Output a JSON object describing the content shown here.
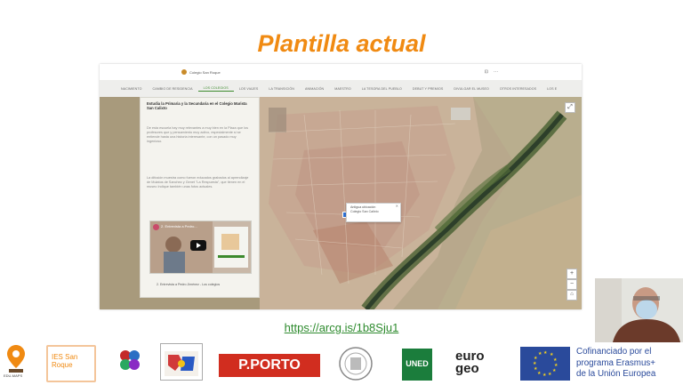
{
  "slide": {
    "title": "Plantilla actual",
    "link": "https://arcg.is/1b8Sju1"
  },
  "app": {
    "brand": "Colegio San Roque",
    "nav": [
      "NACIMIENTO",
      "CAMBIO DE RESIDENCIA",
      "LOS COLEGIOS",
      "LOS VIAJES",
      "LA TRANSICIÓN",
      "ANIMACIÓN",
      "MAESTRO",
      "LA TESORA DEL PUEBLO",
      "DEBUT Y PREMIOS",
      "DIVULGAR EL MUSEO",
      "OTROS INTERESADOS",
      "LOS E"
    ],
    "active_nav": "LOS COLEGIOS",
    "panel": {
      "heading": "Estudia la Primaria y la Secundaria en el Colegio Marista San Calixto",
      "paragraph1": "De esta escuela hay muy relevantes a muy bien en la Plaza que los profesores que y pensamiento muy activo, especialmente si se entiende hasta una historia interesante, con un pasado muy ingenioso.",
      "paragraph2": "La difusión muestra como fueron educados grabados al aprendizaje de Mulatos de Sanchez y Genet \"La Respuesta\", que tienen en el museo Indique también unas fotos actuales.",
      "video_title": "2. Entrevista a Pedro...",
      "video_caption": "2. Entrevista a Pedro Jiménez - Los colegios"
    },
    "popup": {
      "line1": "Antigua ubicación",
      "line2": "Colegio San Calixto"
    }
  },
  "footer": {
    "logos": [
      "EDU-MAPS",
      "IES San Roque",
      "Escola de Ensino",
      "Agrupamento",
      "P.PORTO",
      "Universidade",
      "UNED",
      "euro geo"
    ],
    "eu_text": [
      "Cofinanciado por el",
      "programa Erasmus+",
      "de la Unión Europea"
    ]
  },
  "colors": {
    "title": "#f08a12",
    "link": "#2e8b2e",
    "nav_active": "#3c8a2d",
    "porto_red": "#d12d1f",
    "uned_green": "#1b7d3c",
    "eu_blue": "#2a4a9b"
  }
}
